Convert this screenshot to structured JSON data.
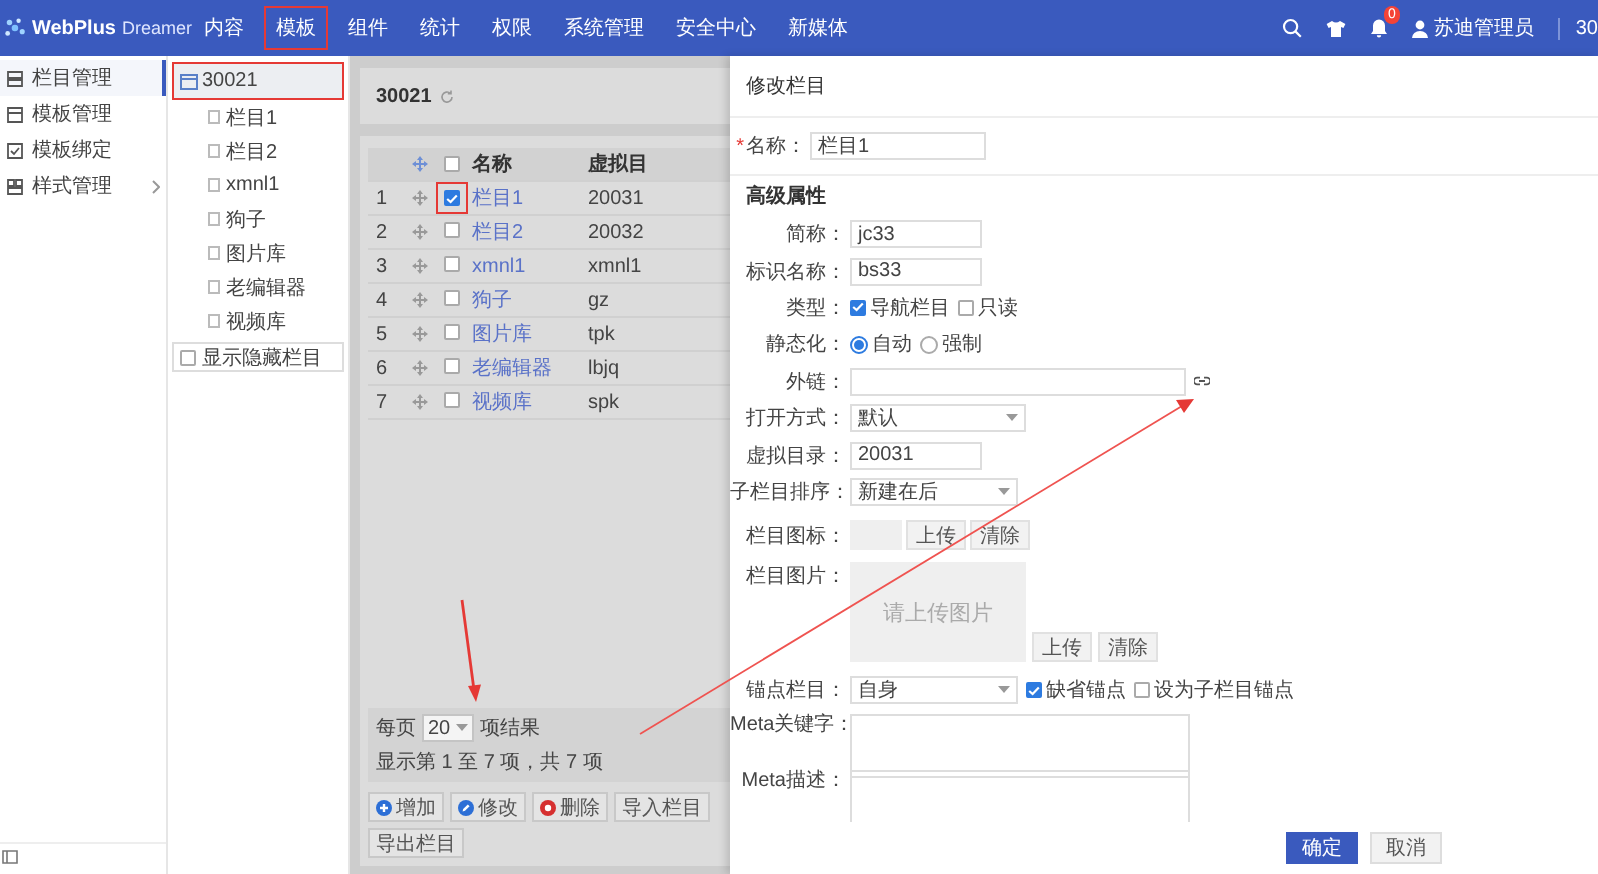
{
  "header": {
    "logo": {
      "name": "WebPlus",
      "suffix": "Dreamer"
    },
    "nav": [
      {
        "label": "内容",
        "selected": false,
        "highlighted": false
      },
      {
        "label": "模板",
        "selected": false,
        "highlighted": true
      },
      {
        "label": "组件",
        "selected": false,
        "highlighted": false
      },
      {
        "label": "统计",
        "selected": false,
        "highlighted": false
      },
      {
        "label": "权限",
        "selected": false,
        "highlighted": false
      },
      {
        "label": "系统管理",
        "selected": false,
        "highlighted": false
      },
      {
        "label": "安全中心",
        "selected": false,
        "highlighted": false
      },
      {
        "label": "新媒体",
        "selected": false,
        "highlighted": false
      }
    ],
    "notification_badge": "0",
    "user": "苏迪管理员",
    "site": "30"
  },
  "sidebar": {
    "items": [
      {
        "label": "栏目管理",
        "selected": true,
        "expandable": false
      },
      {
        "label": "模板管理",
        "selected": false,
        "expandable": false
      },
      {
        "label": "模板绑定",
        "selected": false,
        "expandable": false
      },
      {
        "label": "样式管理",
        "selected": false,
        "expandable": true
      }
    ]
  },
  "tree": {
    "root": {
      "label": "30021",
      "selected": true,
      "highlighted": true,
      "children": [
        {
          "label": "栏目1"
        },
        {
          "label": "栏目2"
        },
        {
          "label": "xmnl1"
        },
        {
          "label": "狗子"
        },
        {
          "label": "图片库"
        },
        {
          "label": "老编辑器"
        },
        {
          "label": "视频库"
        }
      ]
    },
    "show_hidden": {
      "label": "显示隐藏栏目",
      "checked": false
    }
  },
  "list": {
    "title": "30021",
    "columns": [
      "名称",
      "虚拟目"
    ],
    "select_all": {
      "checked": false
    },
    "rows": [
      {
        "index": "1",
        "name": "栏目1",
        "dir": "20031",
        "checked": true,
        "highlighted": true
      },
      {
        "index": "2",
        "name": "栏目2",
        "dir": "20032",
        "checked": false,
        "highlighted": false
      },
      {
        "index": "3",
        "name": "xmnl1",
        "dir": "xmnl1",
        "checked": false,
        "highlighted": false
      },
      {
        "index": "4",
        "name": "狗子",
        "dir": "gz",
        "checked": false,
        "highlighted": false
      },
      {
        "index": "5",
        "name": "图片库",
        "dir": "tpk",
        "checked": false,
        "highlighted": false
      },
      {
        "index": "6",
        "name": "老编辑器",
        "dir": "lbjq",
        "checked": false,
        "highlighted": false
      },
      {
        "index": "7",
        "name": "视频库",
        "dir": "spk",
        "checked": false,
        "highlighted": false
      }
    ],
    "pagination": {
      "per_page_label": "每页",
      "per_page": "20",
      "results_label": "项结果",
      "summary": "显示第 1 至 7 项，共 7 项"
    },
    "actions": [
      {
        "label": "增加",
        "kind": "add"
      },
      {
        "label": "修改",
        "kind": "edit"
      },
      {
        "label": "删除",
        "kind": "delete"
      },
      {
        "label": "导入栏目",
        "kind": "import"
      },
      {
        "label": "导出栏目",
        "kind": "export"
      }
    ]
  },
  "editor": {
    "title": "修改栏目",
    "name": {
      "label": "名称：",
      "required_mark": "*",
      "value": "栏目1"
    },
    "section": "高级属性",
    "fields": [
      {
        "kind": "text",
        "label": "简称：",
        "value": "jc33"
      },
      {
        "kind": "text",
        "label": "标识名称：",
        "value": "bs33"
      },
      {
        "kind": "checks",
        "label": "类型：",
        "options": [
          {
            "label": "导航栏目",
            "checked": true
          },
          {
            "label": "只读",
            "checked": false
          }
        ]
      },
      {
        "kind": "radios",
        "label": "静态化：",
        "options": [
          {
            "label": "自动",
            "selected": true
          },
          {
            "label": "强制",
            "selected": false
          }
        ]
      },
      {
        "kind": "link",
        "label": "外链："
      },
      {
        "kind": "select",
        "label": "打开方式：",
        "value": "默认"
      },
      {
        "kind": "text",
        "label": "虚拟目录：",
        "value": "20031"
      },
      {
        "kind": "select",
        "label": "子栏目排序：",
        "value": "新建在后"
      },
      {
        "kind": "icon",
        "label": "栏目图标：",
        "buttons": [
          "上传",
          "清除"
        ]
      },
      {
        "kind": "image",
        "label": "栏目图片：",
        "placeholder": "请上传图片",
        "buttons": [
          "上传",
          "清除"
        ]
      },
      {
        "kind": "anchor",
        "label": "锚点栏目：",
        "value": "自身",
        "options": [
          {
            "label": "缺省锚点",
            "checked": true
          },
          {
            "label": "设为子栏目锚点",
            "checked": false
          }
        ]
      },
      {
        "kind": "textarea",
        "label": "Meta关键字："
      },
      {
        "kind": "textarea",
        "label": "Meta描述："
      }
    ],
    "buttons": [
      {
        "label": "确定",
        "primary": true
      },
      {
        "label": "取消",
        "primary": false
      }
    ]
  }
}
